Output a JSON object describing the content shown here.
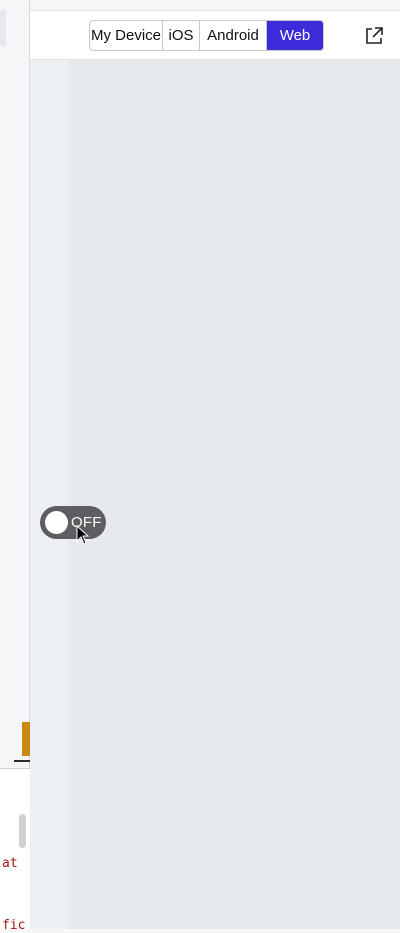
{
  "toolbar": {
    "platforms": [
      "My Device",
      "iOS",
      "Android",
      "Web"
    ],
    "selected_platform": "Web",
    "icons": {
      "external": "external-link-icon"
    }
  },
  "preview": {
    "toggle": {
      "label": "OFF",
      "state": "off"
    }
  },
  "editor_fragment": {
    "code_lines": [
      "at",
      "fic"
    ]
  },
  "colors": {
    "accent": "#3c2bd8",
    "toggle_track": "#5e5e62",
    "preview_bg": "#e7eaed",
    "tab_accent": "#c98a14",
    "code_string": "#a31515"
  }
}
